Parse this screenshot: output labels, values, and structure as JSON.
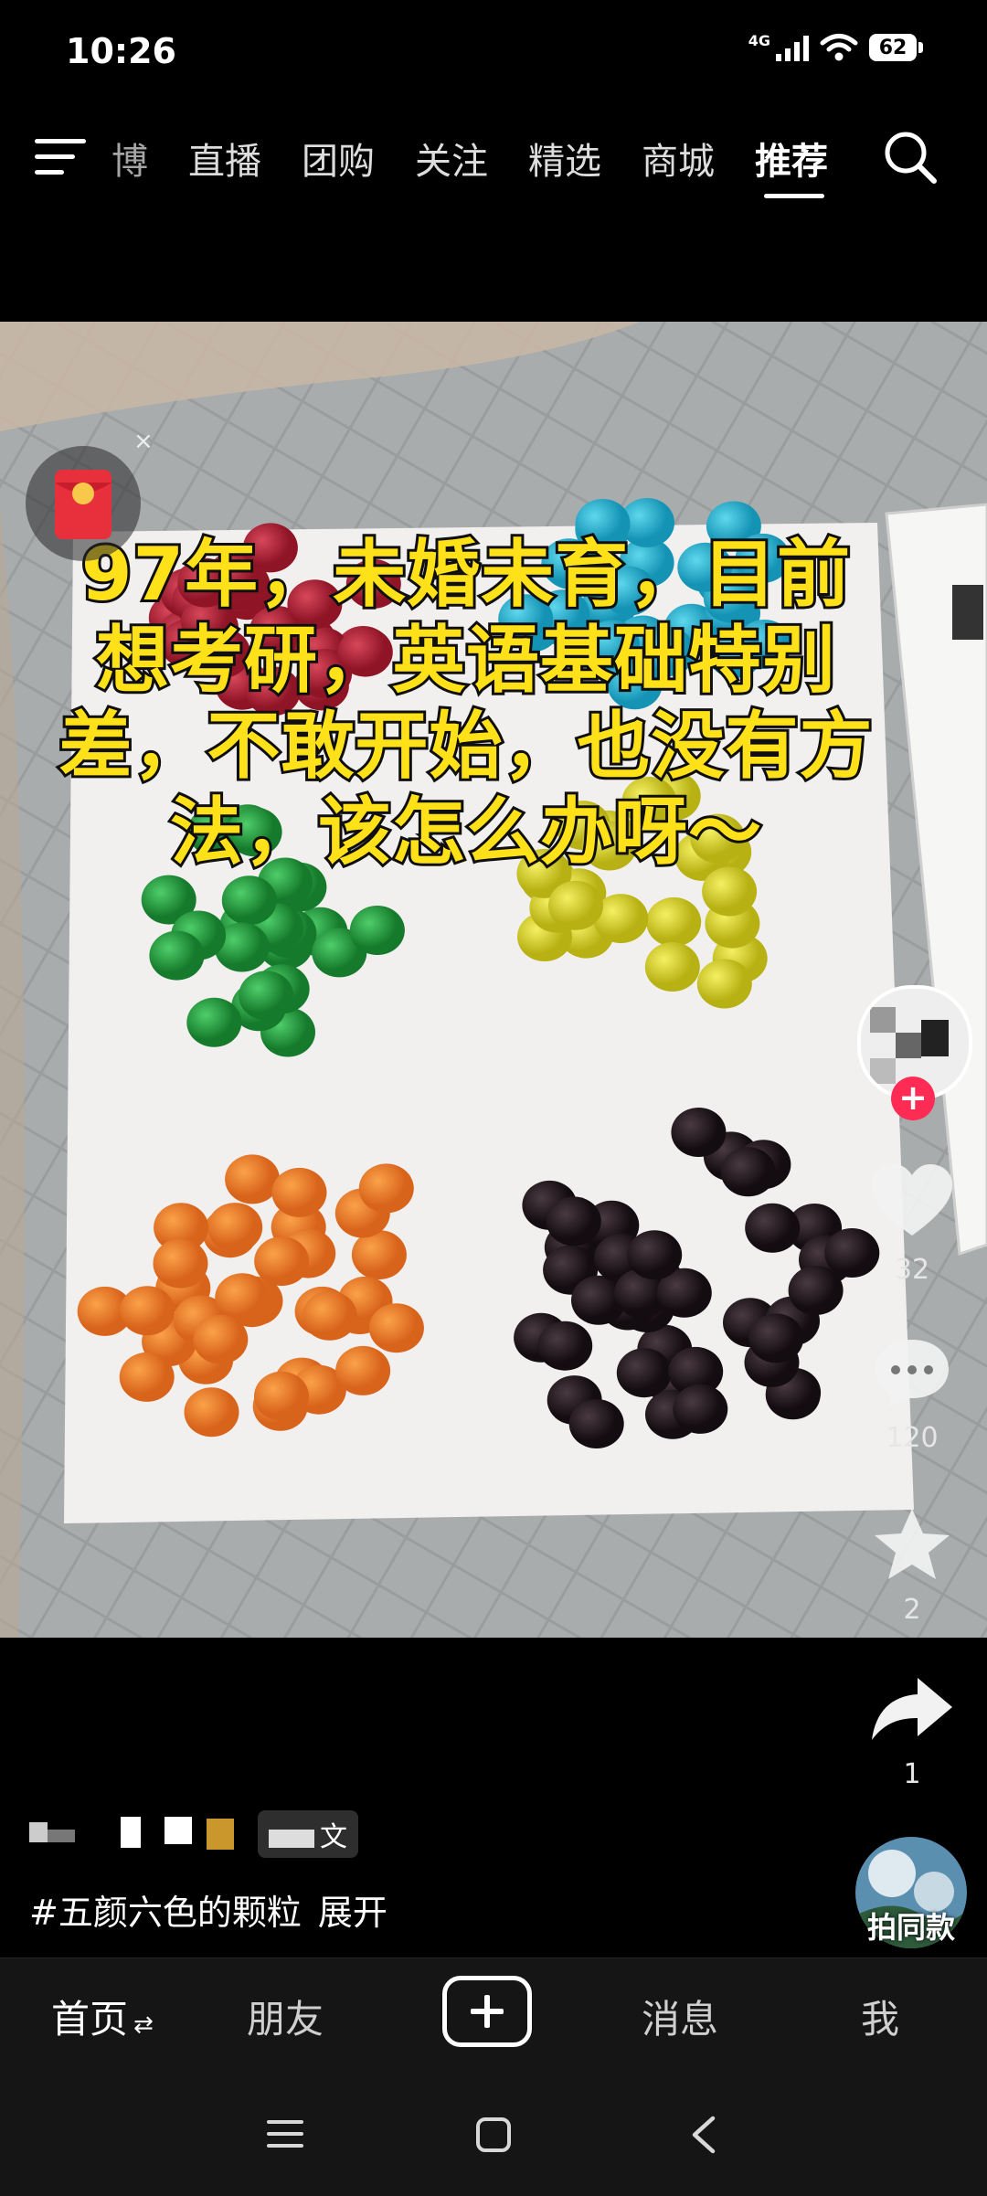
{
  "status_bar": {
    "time": "10:26",
    "network": "4G",
    "battery": "62",
    "icons": [
      "signal-icon",
      "wifi-icon",
      "battery-icon"
    ]
  },
  "top_nav": {
    "tabs": [
      {
        "label": "博",
        "active": false
      },
      {
        "label": "直播",
        "active": false
      },
      {
        "label": "团购",
        "active": false
      },
      {
        "label": "关注",
        "active": false
      },
      {
        "label": "精选",
        "active": false
      },
      {
        "label": "商城",
        "active": false
      },
      {
        "label": "推荐",
        "active": true
      }
    ],
    "icons": [
      "menu-icon",
      "search-icon"
    ]
  },
  "video": {
    "caption": "97年，未婚未育，目前想考研，英语基础特别差，不敢开始，也没有方法，该怎么办呀～",
    "red_packet_close": "×"
  },
  "actions": {
    "likes": "32",
    "comments": "120",
    "favorites": "2",
    "shares": "1",
    "follow_symbol": "+"
  },
  "post": {
    "author_tag": "文",
    "hashtag": "#五颜六色的颗粒",
    "expand": "展开",
    "same_style_label": "拍同款"
  },
  "bottom_tabs": {
    "home": "首页",
    "home_suffix": "⇄",
    "friends": "朋友",
    "messages": "消息",
    "me": "我"
  },
  "colors": {
    "caption": "#ffe11a",
    "follow": "#fe2c55",
    "background": "#000000"
  }
}
